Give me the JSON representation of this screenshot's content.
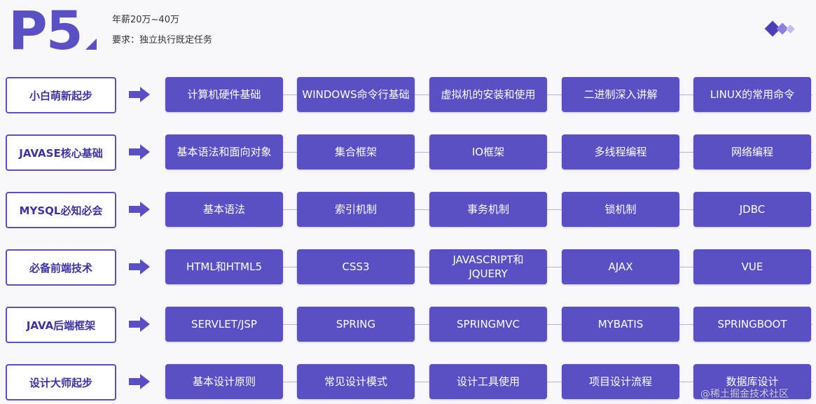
{
  "header": {
    "level": "P5",
    "salary": "年薪20万~40万",
    "requirement": "要求：独立执行既定任务"
  },
  "colors": {
    "accent": "#5a4fc4",
    "category_text": "#3d33a6"
  },
  "rows": [
    {
      "category": "小白萌新起步",
      "topics": [
        "计算机硬件基础",
        "WINDOWS命令行基础",
        "虚拟机的安装和使用",
        "二进制深入讲解",
        "LINUX的常用命令"
      ]
    },
    {
      "category": "JAVASE核心基础",
      "topics": [
        "基本语法和面向对象",
        "集合框架",
        "IO框架",
        "多线程编程",
        "网络编程"
      ]
    },
    {
      "category": "MYSQL必知必会",
      "topics": [
        "基本语法",
        "索引机制",
        "事务机制",
        "锁机制",
        "JDBC"
      ]
    },
    {
      "category": "必备前端技术",
      "topics": [
        "HTML和HTML5",
        "CSS3",
        "JAVASCRIPT和\nJQUERY",
        "AJAX",
        "VUE"
      ]
    },
    {
      "category": "JAVA后端框架",
      "topics": [
        "SERVLET/JSP",
        "SPRING",
        "SPRINGMVC",
        "MYBATIS",
        "SPRINGBOOT"
      ]
    },
    {
      "category": "设计大师起步",
      "topics": [
        "基本设计原则",
        "常见设计模式",
        "设计工具使用",
        "项目设计流程",
        "数据库设计"
      ]
    }
  ],
  "watermark": "@稀土掘金技术社区",
  "icons": {
    "arrow": "arrow-right-icon",
    "logo": "diamond-logo-icon"
  }
}
